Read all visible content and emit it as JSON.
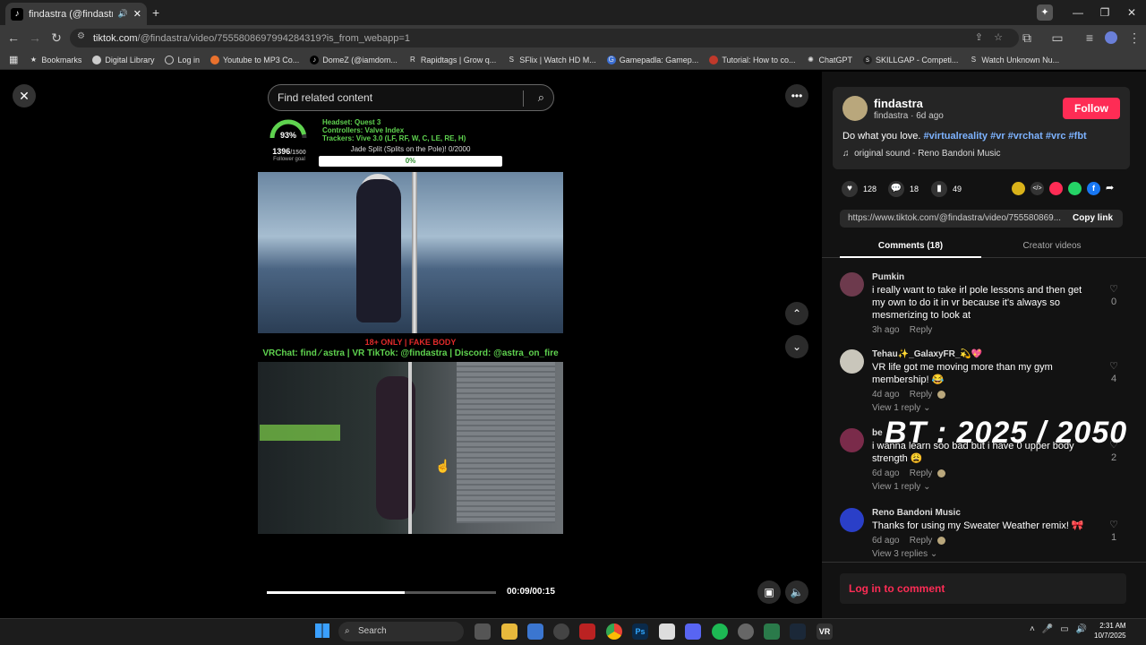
{
  "browser": {
    "tab_title": "findastra (@findastra) | TikT...",
    "tab_favicon": "tiktok-icon",
    "url_host": "tiktok.com",
    "url_path": "/@findastra/video/7555808697994284319?is_from_webapp=1",
    "bookmarks": [
      {
        "label": "Bookmarks",
        "icon": "star-icon"
      },
      {
        "label": "Digital Library",
        "icon": "globe-icon"
      },
      {
        "label": "Log in",
        "icon": "circle-icon"
      },
      {
        "label": "Youtube to MP3 Co...",
        "icon": "orange-circle-icon"
      },
      {
        "label": "DomeZ (@iamdom...",
        "icon": "tiktok-icon"
      },
      {
        "label": "Rapidtags | Grow q...",
        "icon": "r-icon"
      },
      {
        "label": "SFlix | Watch HD M...",
        "icon": "s-icon"
      },
      {
        "label": "Gamepadla: Gamep...",
        "icon": "g-icon"
      },
      {
        "label": "Tutorial: How to co...",
        "icon": "red-circle-icon"
      },
      {
        "label": "ChatGPT",
        "icon": "openai-icon"
      },
      {
        "label": "SKILLGAP - Competi...",
        "icon": "sg-icon"
      },
      {
        "label": "Watch Unknown Nu...",
        "icon": "s-icon"
      }
    ]
  },
  "video": {
    "search_placeholder": "Find related content",
    "gauge_percent": "93%",
    "follower_count": "1396",
    "follower_goal": "/1500",
    "follower_goal_label": "Follower goal",
    "headset": "Headset: Quest 3",
    "controllers": "Controllers: Valve Index",
    "trackers": "Trackers: Vive 3.0 (LF, RF, W, C, LE, RE, H)",
    "split_goal": "Jade Split (Splits on the Pole)! 0/2000",
    "split_percent": "0%",
    "warning": "18+ ONLY | FAKE BODY",
    "socials": "VRChat: find ⁄ astra | VR TikTok: @findastra | Discord: @astra_on_fire",
    "progress": 0.6,
    "time": "00:09/00:15"
  },
  "author": {
    "name": "findastra",
    "handle_line": "findastra · 6d ago",
    "follow_label": "Follow",
    "description": "Do what you love. ",
    "hashtags": "#virtualreality #vr #vrchat #vrc #fbt",
    "sound": "original sound - Reno Bandoni Music",
    "likes": "128",
    "comments_count": "18",
    "saves": "49",
    "link": "https://www.tiktok.com/@findastra/video/755580869...",
    "copy_label": "Copy link"
  },
  "tabs": {
    "comments": "Comments (18)",
    "creator": "Creator videos"
  },
  "comments": [
    {
      "name": "Pumkin",
      "text": "i really want to take irl pole lessons and then get my own to do it in vr because it's always so mesmerizing to look at",
      "time": "3h ago",
      "reply": "Reply",
      "likes": "0",
      "replies": ""
    },
    {
      "name": "Tehau✨_GalaxyFR_💫💖",
      "text": "VR life got me moving more than my gym membership! 😂",
      "time": "4d ago",
      "reply": "Reply",
      "likes": "4",
      "replies": "View 1 reply"
    },
    {
      "name": "be",
      "text": "i wanna learn soo bad but i have 0 upper body strength 😩",
      "time": "6d ago",
      "reply": "Reply",
      "likes": "2",
      "replies": "View 1 reply"
    },
    {
      "name": "Reno Bandoni Music",
      "text": "Thanks for using my Sweater Weather remix! 🎀",
      "time": "6d ago",
      "reply": "Reply",
      "likes": "1",
      "replies": "View 3 replies"
    }
  ],
  "login_prompt": "Log in to comment",
  "overlay_watermark": "BT : 2025 / 2050",
  "taskbar": {
    "search": "Search",
    "time": "2:31 AM",
    "date": "10/7/2025"
  }
}
